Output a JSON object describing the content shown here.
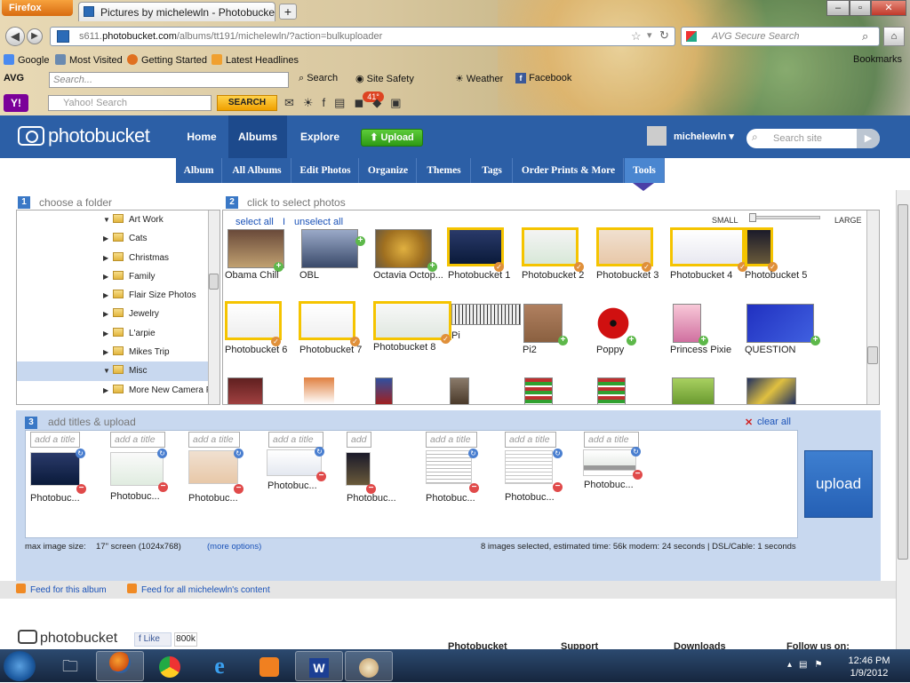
{
  "browser": {
    "app_button": "Firefox",
    "tab_title": "Pictures by michelewln - Photobucket",
    "url_prefix": "s611.",
    "url_domain": "photobucket.com",
    "url_path": "/albums/tt191/michelewln/?action=bulkuploader",
    "search_placeholder": "AVG Secure Search",
    "bookmarks": [
      "Google",
      "Most Visited",
      "Getting Started",
      "Latest Headlines"
    ],
    "bookmarks_right": "Bookmarks",
    "avg_label": "AVG",
    "avg_search_placeholder": "Search...",
    "avg_search_btn": "Search",
    "site_safety": "Site Safety",
    "weather": "Weather",
    "facebook": "Facebook",
    "yahoo_placeholder": "Yahoo! Search",
    "yahoo_search_btn": "SEARCH",
    "temp_badge": "41°"
  },
  "header": {
    "logo": "photobucket",
    "nav": [
      "Home",
      "Albums",
      "Explore"
    ],
    "upload_btn": "Upload",
    "username": "michelewln",
    "search_placeholder": "Search site"
  },
  "subnav": [
    "Album",
    "All Albums",
    "Edit Photos",
    "Organize",
    "Themes",
    "Tags",
    "Order Prints & More",
    "Tools"
  ],
  "step1": {
    "num": "1",
    "title": "choose a folder",
    "folders": [
      "Art Work",
      "Cats",
      "Christmas",
      "Family",
      "Flair Size Photos",
      "Jewelry",
      "L'arpie",
      "Mikes Trip",
      "Misc",
      "More New Camera Pi"
    ]
  },
  "step2": {
    "num": "2",
    "title": "click to select photos",
    "select_all": "select all",
    "separator": "I",
    "unselect_all": "unselect all",
    "size_small": "SMALL",
    "size_large": "LARGE",
    "row1": [
      "Obama Chill",
      "OBL",
      "Octavia Octop...",
      "Photobucket 1",
      "Photobucket 2",
      "Photobucket 3",
      "Photobucket 4",
      "Photobucket 5"
    ],
    "row2": [
      "Photobucket 6",
      "Photobucket 7",
      "Photobucket 8",
      "Pi",
      "Pi2",
      "Poppy",
      "Princess Pixie",
      "QUESTION"
    ]
  },
  "step3": {
    "num": "3",
    "title": "add titles & upload",
    "clear_all": "clear all",
    "title_placeholder": "add a title",
    "short_placeholder": "add",
    "item_names": [
      "Photobuc...",
      "Photobuc...",
      "Photobuc...",
      "Photobuc...",
      "Photobuc...",
      "Photobuc...",
      "Photobuc...",
      "Photobuc..."
    ],
    "max_size_label": "max image size:",
    "max_size_value": "17\" screen (1024x768)",
    "more_options": "(more options)",
    "status": "8 images selected, estimated time: 56k modem: 24 seconds | DSL/Cable: 1 seconds",
    "upload_btn": "upload"
  },
  "feeds": {
    "album": "Feed for this album",
    "all": "Feed for all michelewln's content"
  },
  "footer": {
    "logo": "photobucket",
    "like": "Like",
    "like_count": "800k",
    "cols": [
      "Photobucket",
      "Support",
      "Downloads",
      "Follow us on:"
    ]
  },
  "taskbar": {
    "time": "12:46 PM",
    "date": "1/9/2012"
  }
}
